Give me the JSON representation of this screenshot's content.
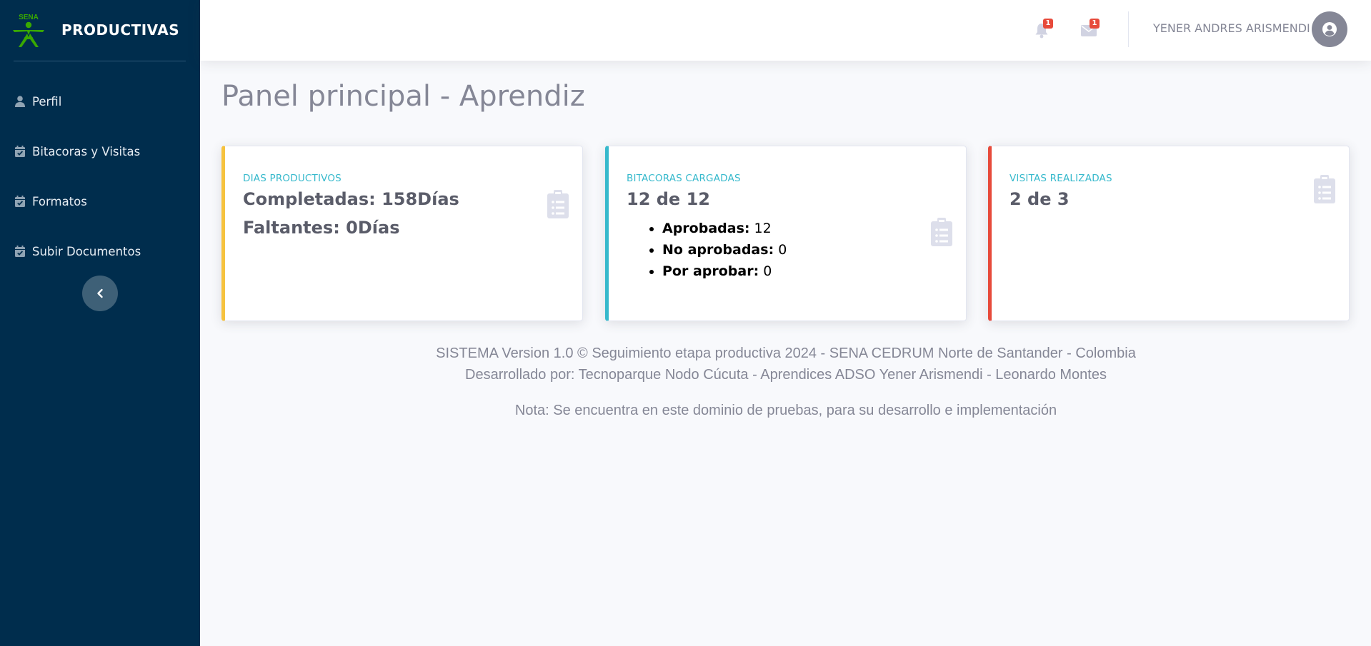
{
  "brand": {
    "title": "PRODUCTIVAS",
    "logo_text": "SENA"
  },
  "sidebar": {
    "items": [
      {
        "label": "Perfil",
        "icon": "user-icon"
      },
      {
        "label": "Bitacoras y Visitas",
        "icon": "calendar-check-icon"
      },
      {
        "label": "Formatos",
        "icon": "calendar-check-icon"
      },
      {
        "label": "Subir Documentos",
        "icon": "calendar-check-icon"
      }
    ],
    "toggle_icon": "chevron-left-icon"
  },
  "topbar": {
    "notifications_count": "1",
    "messages_count": "1",
    "user_name": "YENER ANDRES ARISMENDI"
  },
  "page": {
    "title": "Panel principal - Aprendiz"
  },
  "cards": {
    "dias": {
      "label": "DIAS PRODUCTIVOS",
      "completadas": "Completadas: 158Días",
      "faltantes": "Faltantes: 0Días",
      "accent": "#f6c23e"
    },
    "bitacoras": {
      "label": "BITACORAS CARGADAS",
      "value": "12 de 12",
      "items": [
        {
          "label": "Aprobadas:",
          "value": "12"
        },
        {
          "label": "No aprobadas:",
          "value": "0"
        },
        {
          "label": "Por aprobar:",
          "value": "0"
        }
      ],
      "accent": "#36b9cc"
    },
    "visitas": {
      "label": "VISITAS REALIZADAS",
      "value": "2 de 3",
      "accent": "#e74a3b"
    }
  },
  "footer": {
    "line1": "SISTEMA Version 1.0 © Seguimiento etapa productiva 2024 - SENA CEDRUM Norte de Santander - Colombia",
    "line2": "Desarrollado por: Tecnoparque Nodo Cúcuta - Aprendices ADSO Yener Arismendi - Leonardo Montes",
    "note": "Nota: Se encuentra en este dominio de pruebas, para su desarrollo e implementación"
  },
  "colors": {
    "sidebar_bg": "#002d4d",
    "brand_green": "#39a900",
    "card_label": "#36b9cc",
    "text_gray": "#858796"
  }
}
